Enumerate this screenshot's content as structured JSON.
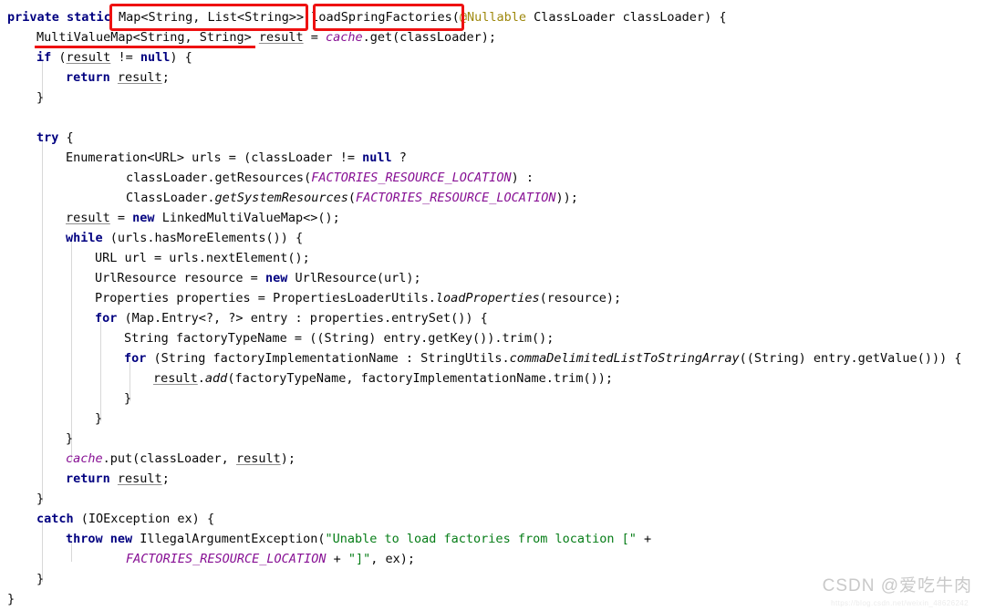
{
  "editor": {
    "language": "java",
    "font_size_px": 13.5,
    "line_height_px": 22,
    "background": "#ffffff",
    "colors": {
      "keyword": "#000080",
      "string": "#067d17",
      "annotation": "#9e880d",
      "static_field": "#871094",
      "plain_text": "#080808",
      "indent_guide": "#d8d8d8",
      "highlight_red": "#ee1111",
      "watermark_gray": "#c9c9c9"
    },
    "lines": [
      {
        "n": 1,
        "indent": 0,
        "text": "private static Map<String, List<String>> loadSpringFactories(@Nullable ClassLoader classLoader) {"
      },
      {
        "n": 2,
        "indent": 1,
        "text": "MultiValueMap<String, String> result = cache.get(classLoader);"
      },
      {
        "n": 3,
        "indent": 1,
        "text": "if (result != null) {"
      },
      {
        "n": 4,
        "indent": 2,
        "text": "return result;"
      },
      {
        "n": 5,
        "indent": 1,
        "text": "}"
      },
      {
        "n": 6,
        "indent": 0,
        "text": ""
      },
      {
        "n": 7,
        "indent": 1,
        "text": "try {"
      },
      {
        "n": 8,
        "indent": 2,
        "text": "Enumeration<URL> urls = (classLoader != null ?"
      },
      {
        "n": 9,
        "indent": 4,
        "text": "classLoader.getResources(FACTORIES_RESOURCE_LOCATION) :"
      },
      {
        "n": 10,
        "indent": 4,
        "text": "ClassLoader.getSystemResources(FACTORIES_RESOURCE_LOCATION));"
      },
      {
        "n": 11,
        "indent": 2,
        "text": "result = new LinkedMultiValueMap<>();"
      },
      {
        "n": 12,
        "indent": 2,
        "text": "while (urls.hasMoreElements()) {"
      },
      {
        "n": 13,
        "indent": 3,
        "text": "URL url = urls.nextElement();"
      },
      {
        "n": 14,
        "indent": 3,
        "text": "UrlResource resource = new UrlResource(url);"
      },
      {
        "n": 15,
        "indent": 3,
        "text": "Properties properties = PropertiesLoaderUtils.loadProperties(resource);"
      },
      {
        "n": 16,
        "indent": 3,
        "text": "for (Map.Entry<?, ?> entry : properties.entrySet()) {"
      },
      {
        "n": 17,
        "indent": 4,
        "text": "String factoryTypeName = ((String) entry.getKey()).trim();"
      },
      {
        "n": 18,
        "indent": 4,
        "text": "for (String factoryImplementationName : StringUtils.commaDelimitedListToStringArray((String) entry.getValue())) {"
      },
      {
        "n": 19,
        "indent": 5,
        "text": "result.add(factoryTypeName, factoryImplementationName.trim());"
      },
      {
        "n": 20,
        "indent": 4,
        "text": "}"
      },
      {
        "n": 21,
        "indent": 3,
        "text": "}"
      },
      {
        "n": 22,
        "indent": 2,
        "text": "}"
      },
      {
        "n": 23,
        "indent": 2,
        "text": "cache.put(classLoader, result);"
      },
      {
        "n": 24,
        "indent": 2,
        "text": "return result;"
      },
      {
        "n": 25,
        "indent": 1,
        "text": "}"
      },
      {
        "n": 26,
        "indent": 1,
        "text": "catch (IOException ex) {"
      },
      {
        "n": 27,
        "indent": 2,
        "text": "throw new IllegalArgumentException(\"Unable to load factories from location [\" +"
      },
      {
        "n": 28,
        "indent": 4,
        "text": "FACTORIES_RESOURCE_LOCATION + \"]\", ex);"
      },
      {
        "n": 29,
        "indent": 1,
        "text": "}"
      },
      {
        "n": 30,
        "indent": 0,
        "text": "}"
      }
    ],
    "annotations": {
      "highlight_box_return_type": "Map<String, List<String>>",
      "highlight_box_method_name": "loadSpringFactories(",
      "red_underline_target": "MultiValueMap<String, String>"
    }
  },
  "watermark": {
    "text": "CSDN @爱吃牛肉",
    "url": "https://blog.csdn.net/weixin_48626242"
  }
}
